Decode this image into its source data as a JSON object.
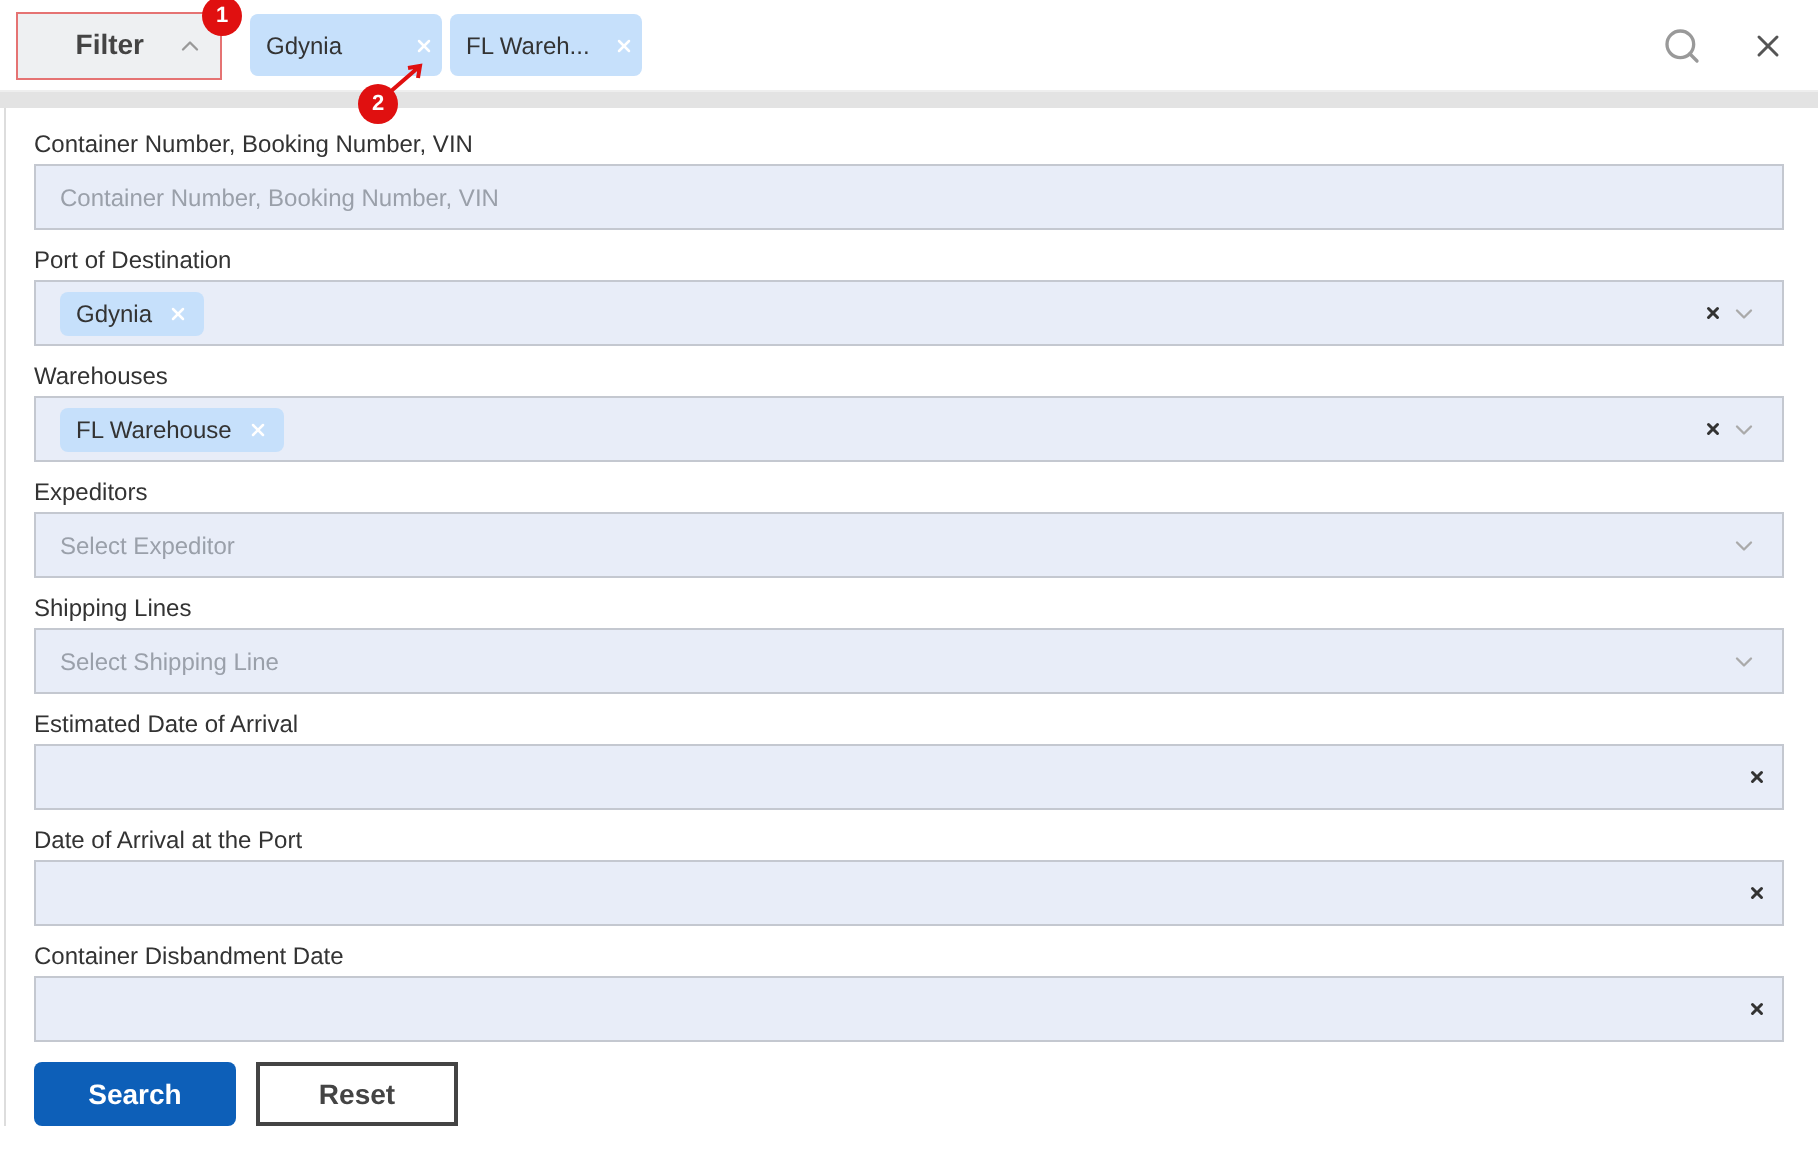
{
  "toolbar": {
    "filter_button": {
      "label": "Filter",
      "expanded": true
    },
    "active_filters": [
      {
        "label": "Gdynia"
      },
      {
        "label": "FL Wareh..."
      }
    ]
  },
  "annotations": [
    {
      "label": "1",
      "kind": "badge"
    },
    {
      "label": "2",
      "kind": "arrow"
    }
  ],
  "fields": [
    {
      "kind": "text",
      "label": "Container Number, Booking Number, VIN",
      "placeholder": "Container Number, Booking Number, VIN"
    },
    {
      "kind": "select",
      "label": "Port of Destination",
      "chips": [
        "Gdynia"
      ]
    },
    {
      "kind": "select",
      "label": "Warehouses",
      "chips": [
        "FL Warehouse"
      ]
    },
    {
      "kind": "select",
      "label": "Expeditors",
      "placeholder": "Select Expeditor"
    },
    {
      "kind": "select",
      "label": "Shipping Lines",
      "placeholder": "Select Shipping Line"
    },
    {
      "kind": "date",
      "label": "Estimated Date of Arrival"
    },
    {
      "kind": "date",
      "label": "Date of Arrival at the Port"
    },
    {
      "kind": "date",
      "label": "Container Disbandment Date"
    }
  ],
  "buttons": [
    {
      "kind": "primary",
      "label": "Search"
    },
    {
      "kind": "secondary",
      "label": "Reset"
    }
  ]
}
